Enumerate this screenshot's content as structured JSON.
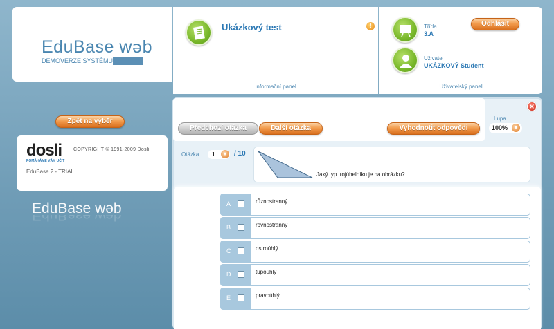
{
  "header": {
    "logo_text": "EduBase w",
    "logo_text_end": "b",
    "logo_subtitle": "DEMOVERZE SYSTÉMU"
  },
  "info_panel": {
    "test_title": "Ukázkový test",
    "footer": "Informační panel"
  },
  "user_panel": {
    "class_label": "Třída",
    "class_value": "3.A",
    "user_label": "Uživatel",
    "user_value": "UKÁZKOVÝ Student",
    "logout_label": "Odhlásit",
    "footer": "Uživatelský panel"
  },
  "sidebar": {
    "back_label": "Zpět na výběr",
    "dosli_word": "dosli",
    "dosli_tagline": "POMÁHÁME VÁM UČIT",
    "copyright": "COPYRIGHT © 1991-2009 Dosli",
    "trial": "EduBase 2 - TRIAL",
    "bottom_logo": "EduBase w",
    "bottom_logo_end": "b"
  },
  "toolbar": {
    "prev_label": "Předchozí otázka",
    "next_label": "Další otázka",
    "evaluate_label": "Vyhodnotit odpovědi",
    "zoom_label": "Lupa",
    "zoom_value": "100%"
  },
  "question": {
    "label": "Otázka",
    "current": "1",
    "total": "/ 10",
    "text": "Jaký typ trojúhelníku je na obrázku?"
  },
  "answers": [
    {
      "letter": "A",
      "text": "různostranný"
    },
    {
      "letter": "B",
      "text": "rovnostranný"
    },
    {
      "letter": "C",
      "text": "ostroúhlý"
    },
    {
      "letter": "D",
      "text": "tupoúhlý"
    },
    {
      "letter": "E",
      "text": "pravoúhlý"
    }
  ]
}
